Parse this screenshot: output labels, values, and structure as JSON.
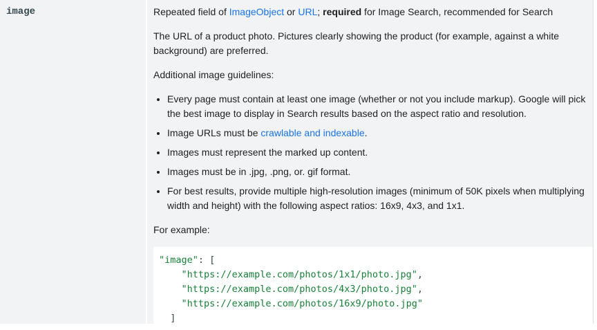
{
  "property": {
    "name": "image"
  },
  "description": {
    "type_line": {
      "prefix": "Repeated field of ",
      "link1": "ImageObject",
      "or": " or ",
      "link2": "URL",
      "semicolon": "; ",
      "required": "required",
      "suffix": " for Image Search, recommended for Search"
    },
    "summary": "The URL of a product photo. Pictures clearly showing the product (for example, against a white background) are preferred.",
    "guidelines_heading": "Additional image guidelines:",
    "guidelines": [
      "Every page must contain at least one image (whether or not you include markup). Google will pick the best image to display in Search results based on the aspect ratio and resolution.",
      "Images must represent the marked up content.",
      "Images must be in .jpg, .png, or. gif format.",
      "For best results, provide multiple high-resolution images (minimum of 50K pixels when multiplying width and height) with the following aspect ratios: 16x9, 4x3, and 1x1."
    ],
    "crawlable_item": {
      "prefix": "Image URLs must be ",
      "link": "crawlable and indexable",
      "suffix": "."
    },
    "example_label": "For example:",
    "code": {
      "key": "\"image\"",
      "colon_bracket": ": [",
      "urls": [
        "\"https://example.com/photos/1x1/photo.jpg\"",
        "\"https://example.com/photos/4x3/photo.jpg\"",
        "\"https://example.com/photos/16x9/photo.jpg\""
      ],
      "comma": ",",
      "close": "]"
    }
  },
  "colors": {
    "link": "#1a73e8",
    "code_string": "#188038",
    "cell_background": "#f1f3f4"
  }
}
